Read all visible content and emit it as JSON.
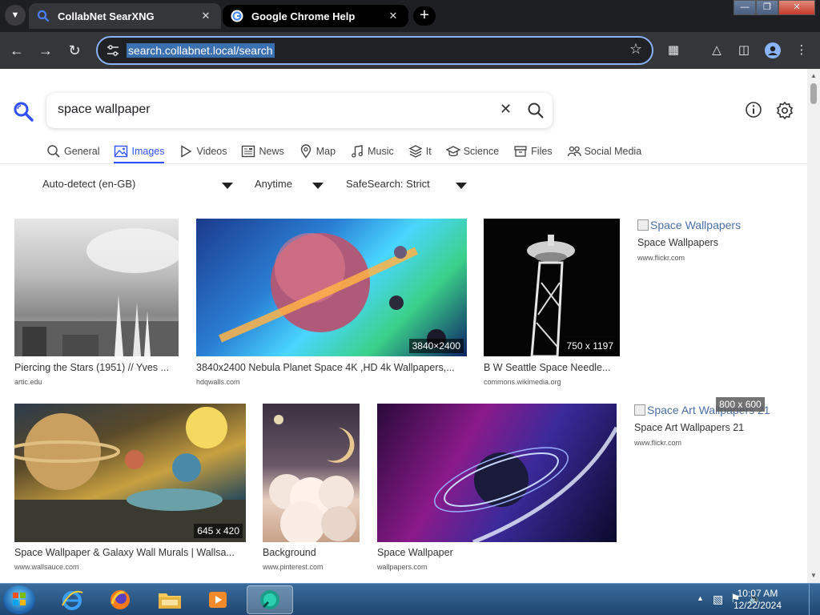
{
  "browser": {
    "tabs": [
      {
        "title": "CollabNet SearXNG"
      },
      {
        "title": "Google Chrome Help"
      }
    ],
    "url": "search.collabnet.local/search"
  },
  "search": {
    "query": "space wallpaper",
    "categories": [
      "General",
      "Images",
      "Videos",
      "News",
      "Map",
      "Music",
      "It",
      "Science",
      "Files",
      "Social Media"
    ],
    "active_category": "Images",
    "filters": {
      "language": "Auto-detect (en-GB)",
      "time": "Anytime",
      "safesearch": "SafeSearch: Strict"
    }
  },
  "results": [
    {
      "title": "Piercing the Stars (1951) // Yves ...",
      "url": "artic.edu",
      "resolution": ""
    },
    {
      "title": "3840x2400 Nebula Planet Space 4K ,HD 4k Wallpapers,...",
      "url": "hdqwalls.com",
      "resolution": "3840×2400"
    },
    {
      "title": "B W Seattle Space Needle...",
      "url": "commons.wikimedia.org",
      "resolution": "750 x 1197"
    },
    {
      "title": "Space Wallpapers",
      "url": "www.flickr.com",
      "resolution": "",
      "alt": "Space Wallpapers"
    },
    {
      "title": "Space Wallpaper & Galaxy Wall Murals | Wallsa...",
      "url": "www.wallsauce.com",
      "resolution": "645 x 420"
    },
    {
      "title": "Background",
      "url": "www.pinterest.com",
      "resolution": ""
    },
    {
      "title": "Space Wallpaper",
      "url": "wallpapers.com",
      "resolution": ""
    },
    {
      "title": "Space Art Wallpapers 21",
      "url": "www.flickr.com",
      "resolution": "800 x 600",
      "alt": "Space Art Wallpapers 21"
    }
  ],
  "taskbar": {
    "time": "10:07 AM",
    "date": "12/22/2024"
  }
}
